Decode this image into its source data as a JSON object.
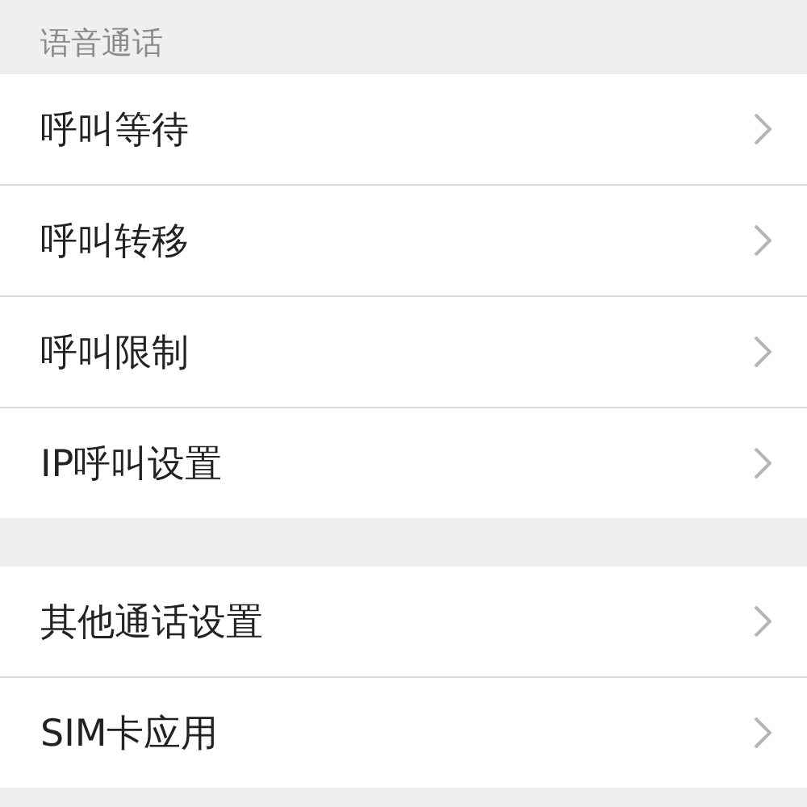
{
  "sections": [
    {
      "header": "语音通话",
      "items": [
        {
          "label": "呼叫等待"
        },
        {
          "label": "呼叫转移"
        },
        {
          "label": "呼叫限制"
        },
        {
          "label": "IP呼叫设置"
        }
      ]
    },
    {
      "items": [
        {
          "label": "其他通话设置"
        },
        {
          "label": "SIM卡应用"
        }
      ]
    }
  ]
}
